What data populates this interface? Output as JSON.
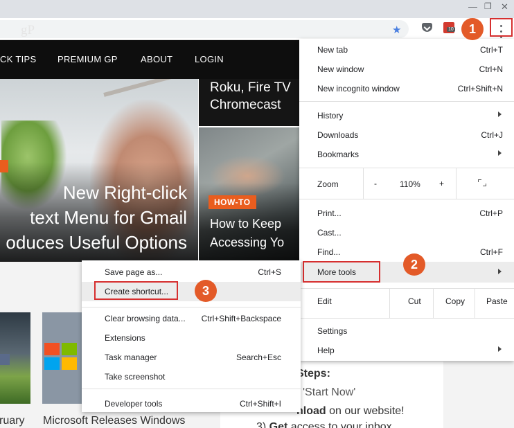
{
  "browser": {
    "ghost_logo": "gP",
    "ext_badge": "10"
  },
  "site": {
    "nav": [
      "CK TIPS",
      "PREMIUM GP",
      "ABOUT",
      "LOGIN"
    ],
    "hero_title": "New Right-click\ntext Menu for Gmail\noduces Useful Options",
    "right_top_title": "Roku, Fire TV\nChromecast",
    "howto_tag": "HOW-TO",
    "right_bottom_title": "How to Keep\nAccessing Yo",
    "caption_left": "ruary",
    "caption_mid": "Microsoft Releases Windows",
    "steps": {
      "heading": "Steps:",
      "line1": "'Start Now'",
      "line2_bold": "nload",
      "line2_rest": " on our website!",
      "line3_num": "3) ",
      "line3_bold": "Get",
      "line3_rest": " access to your inbox"
    }
  },
  "main_menu": {
    "new_tab": {
      "label": "New tab",
      "accel": "Ctrl+T"
    },
    "new_window": {
      "label": "New window",
      "accel": "Ctrl+N"
    },
    "new_incognito": {
      "label": "New incognito window",
      "accel": "Ctrl+Shift+N"
    },
    "history": {
      "label": "History"
    },
    "downloads": {
      "label": "Downloads",
      "accel": "Ctrl+J"
    },
    "bookmarks": {
      "label": "Bookmarks"
    },
    "zoom": {
      "label": "Zoom",
      "minus": "-",
      "level": "110%",
      "plus": "+"
    },
    "print": {
      "label": "Print...",
      "accel": "Ctrl+P"
    },
    "cast": {
      "label": "Cast..."
    },
    "find": {
      "label": "Find...",
      "accel": "Ctrl+F"
    },
    "more_tools": {
      "label": "More tools"
    },
    "edit": {
      "label": "Edit",
      "cut": "Cut",
      "copy": "Copy",
      "paste": "Paste"
    },
    "settings": {
      "label": "Settings"
    },
    "help": {
      "label": "Help"
    }
  },
  "more_tools_menu": {
    "save_page": {
      "label": "Save page as...",
      "accel": "Ctrl+S"
    },
    "create_shortcut": {
      "label": "Create shortcut..."
    },
    "clear_browsing": {
      "label": "Clear browsing data...",
      "accel": "Ctrl+Shift+Backspace"
    },
    "extensions": {
      "label": "Extensions"
    },
    "task_manager": {
      "label": "Task manager",
      "accel": "Search+Esc"
    },
    "take_screenshot": {
      "label": "Take screenshot"
    },
    "developer_tools": {
      "label": "Developer tools",
      "accel": "Ctrl+Shift+I"
    }
  },
  "steps_markers": {
    "one": "1",
    "two": "2",
    "three": "3"
  },
  "colors": {
    "accent": "#e35a28",
    "highlight_border": "#d62f2f",
    "tag_orange": "#e95d1e"
  },
  "icons": [
    "minimize-icon",
    "maximize-icon",
    "close-icon",
    "star-icon",
    "pocket-icon",
    "extension-icon",
    "kebab-menu-icon",
    "submenu-arrow-icon",
    "fullscreen-icon"
  ]
}
